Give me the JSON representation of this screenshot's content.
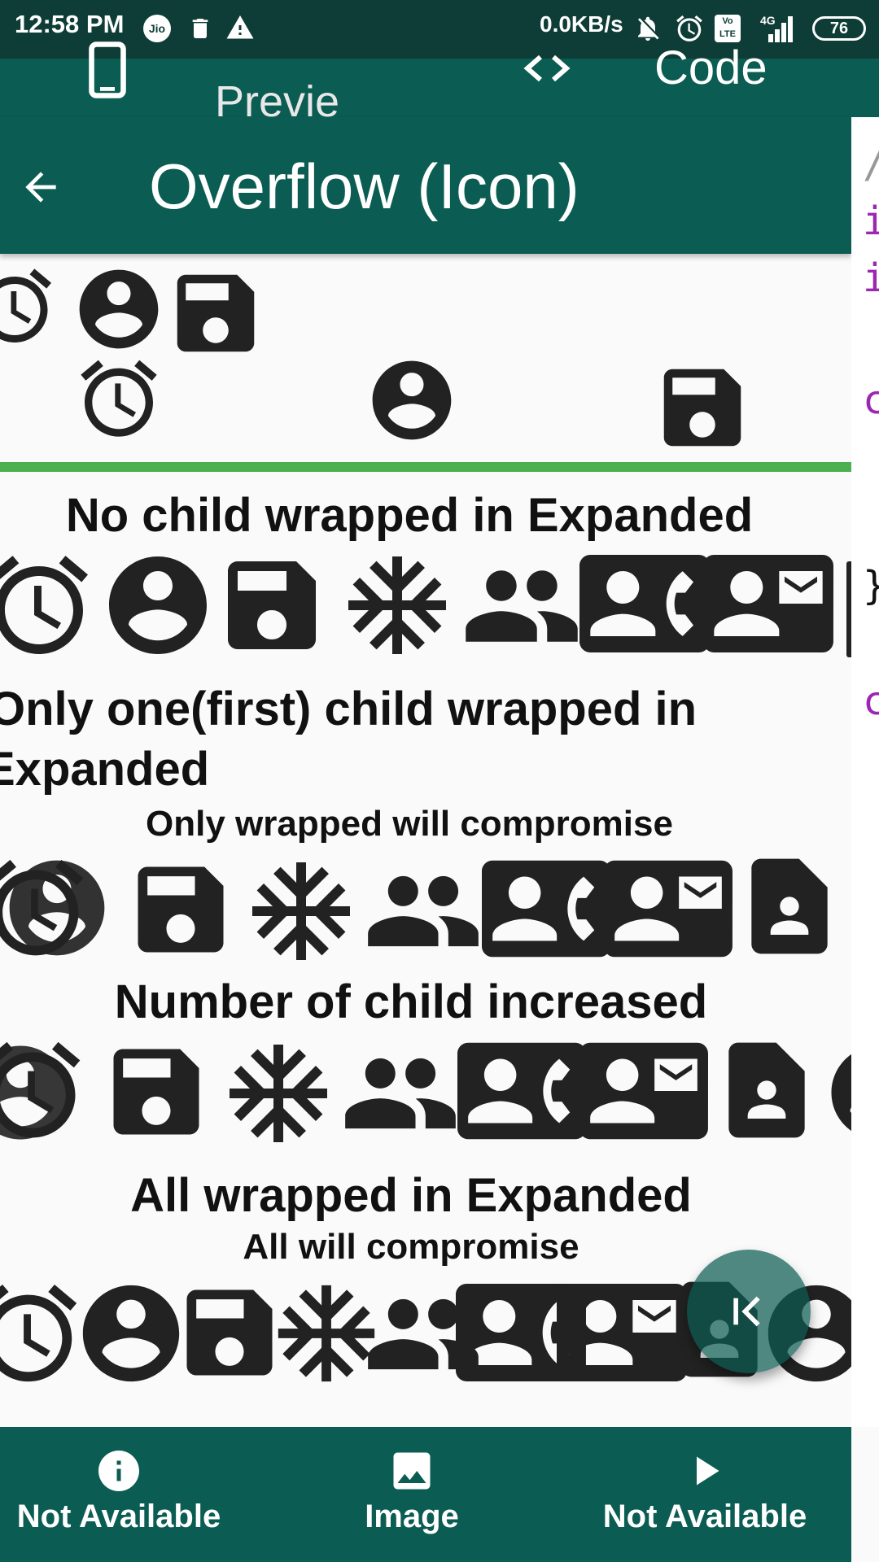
{
  "status_bar": {
    "time": "12:58 PM",
    "network_speed": "0.0KB/s",
    "battery": "76",
    "icons": [
      "jio-icon",
      "trash-icon",
      "warning-icon",
      "mute-icon",
      "alarm-icon",
      "volte-icon",
      "signal-icon",
      "battery-icon"
    ]
  },
  "top_tabs": {
    "preview_label": "Previe w",
    "code_label": "Code"
  },
  "app_bar": {
    "title": "Overflow (Icon)"
  },
  "sections": {
    "no_child": "No child wrapped in Expanded",
    "only_first_line1": "Only one(first) child wrapped in",
    "only_first_line2": "Expanded",
    "only_wrapped_compromise": "Only wrapped will compromise",
    "number_increased": "Number of child increased",
    "all_wrapped": "All wrapped in Expanded",
    "all_compromise": "All will compromise"
  },
  "code_peek": [
    "/",
    "i",
    "i",
    "c",
    "}",
    "c"
  ],
  "bottom_nav": {
    "items": [
      {
        "label": "Not Available",
        "icon": "info-icon"
      },
      {
        "label": "Image",
        "icon": "image-icon"
      },
      {
        "label": "Not Available",
        "icon": "play-icon"
      }
    ]
  },
  "colors": {
    "primary": "#0b5c52",
    "status_bar": "#0d3d36",
    "divider": "#4caf50",
    "code_purple": "#9c27b0"
  }
}
